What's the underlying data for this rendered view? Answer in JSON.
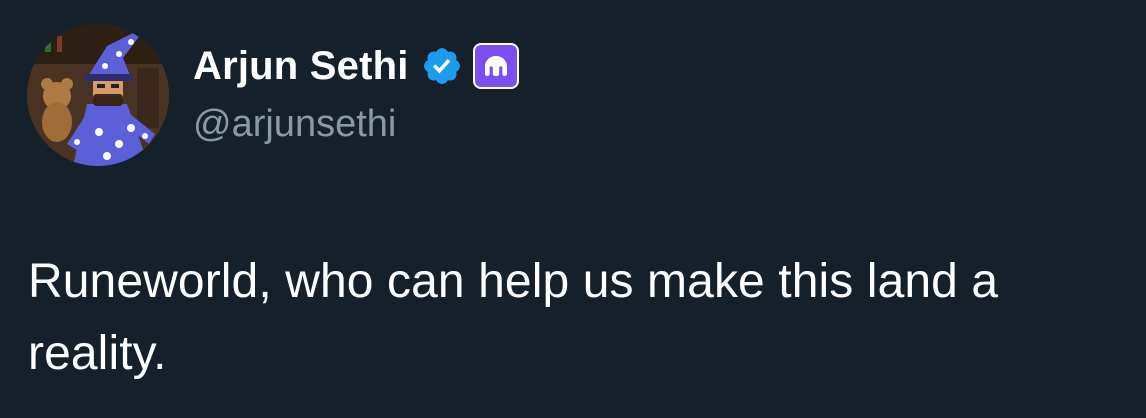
{
  "author": {
    "display_name": "Arjun Sethi",
    "handle": "@arjunsethi",
    "avatar_icon": "wizard-avatar-icon",
    "verified": true,
    "verified_color": "#1d9bf0",
    "affiliate_badge_icon": "kraken-logo-icon",
    "affiliate_badge_color": "#7b4ef0"
  },
  "tweet": {
    "text": "Runeworld, who can help us make this land a reality."
  },
  "colors": {
    "background": "#15202b",
    "primary_text": "#ffffff",
    "secondary_text": "#8b98a5"
  }
}
